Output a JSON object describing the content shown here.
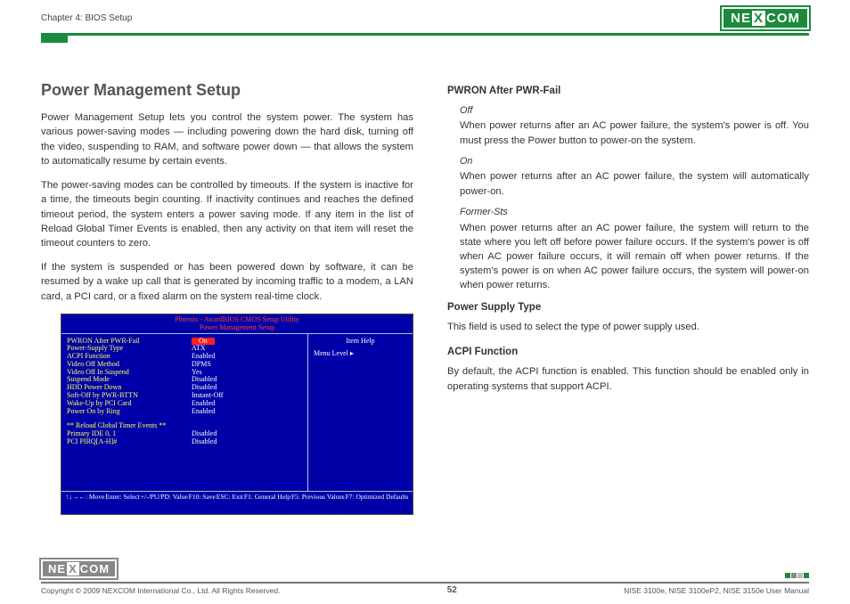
{
  "header": {
    "chapter": "Chapter 4: BIOS Setup",
    "brand_pre": "NE",
    "brand_x": "X",
    "brand_post": "COM"
  },
  "left": {
    "title": "Power Management Setup",
    "p1": "Power Management Setup lets you control the system power. The system has various power-saving modes — including powering down the hard disk, turning off the video, suspending to RAM, and software power down — that allows the system to automatically resume by certain events.",
    "p2": "The power-saving modes can be controlled by timeouts. If the system is inactive for a time, the timeouts begin counting. If inactivity continues and reaches the defined timeout period, the system enters a power saving mode. If any item in the list of Reload Global Timer Events is enabled, then any activity on that item will reset the timeout counters to zero.",
    "p3": "If the system is suspended or has been powered down by software, it can be resumed by a wake up call that is generated by incoming traffic to a modem, a LAN card, a PCI card, or a fixed alarm on the system real-time clock."
  },
  "bios": {
    "title1": "Phoenix - AwardBIOS CMOS Setup Utility",
    "title2": "Power Management Setup",
    "rows": [
      {
        "k": "PWRON After PWR-Fail",
        "v": "On",
        "sel": true
      },
      {
        "k": "Power-Supply Type",
        "v": "ATX"
      },
      {
        "k": "ACPI Function",
        "v": "Enabled"
      },
      {
        "k": "Video Off Method",
        "v": "DPMS"
      },
      {
        "k": "Video Off In Suspend",
        "v": "Yes"
      },
      {
        "k": "Suspend Mode",
        "v": "Disabled"
      },
      {
        "k": "HDD Power Down",
        "v": "Disabled"
      },
      {
        "k": "Soft-Off by PWR-BTTN",
        "v": "Instant-Off"
      },
      {
        "k": "Wake-Up by PCI Card",
        "v": "Enabled"
      },
      {
        "k": "Power On by Ring",
        "v": "Enabled"
      }
    ],
    "section": "** Reload Global Timer Events **",
    "rows2": [
      {
        "k": "Primary IDE 0, 1",
        "v": "Disabled"
      },
      {
        "k": "PCI PIRQ[A-H]#",
        "v": "Disabled"
      }
    ],
    "help_title": "Item Help",
    "menu_level": "Menu Level",
    "footer": [
      "↑↓→←: Move",
      "Enter: Select",
      "+/-/PU/PD: Value",
      "F10: Save",
      "ESC: Exit",
      "F1: General Help",
      "F5: Previous Values",
      "F7: Optimized Defaults"
    ]
  },
  "right": {
    "h1": "PWRON After PWR-Fail",
    "off_l": "Off",
    "off_t": "When power returns after an AC power failure, the system's power is off. You must press the Power button to power-on the system.",
    "on_l": "On",
    "on_t": "When power returns after an AC power failure, the system will automatically power-on.",
    "fs_l": "Former-Sts",
    "fs_t": "When power returns after an AC power failure, the system will return to the state where you left off before power failure occurs. If the system's power is off when AC power failure occurs, it will remain off when power returns. If the system's power is on when AC power failure occurs, the system will power-on when power returns.",
    "h2": "Power Supply Type",
    "p2": "This field is used to select the type of power supply used.",
    "h3": "ACPI Function",
    "p3": "By default, the ACPI function is enabled. This function should be enabled only in operating systems that support ACPI."
  },
  "footer": {
    "copyright": "Copyright © 2009 NEXCOM International Co., Ltd. All Rights Reserved.",
    "page": "52",
    "manual": "NISE 3100e, NISE 3100eP2, NISE 3150e User Manual"
  }
}
